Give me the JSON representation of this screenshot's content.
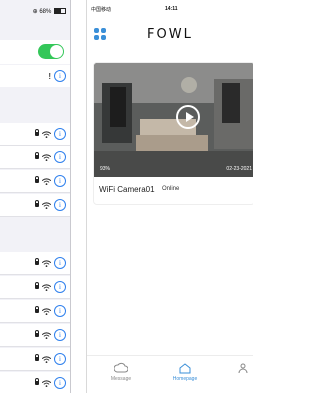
{
  "left_screen": {
    "battery_text": "68%",
    "wifi_enabled": true,
    "info_glyph": "i",
    "alert_glyph": "!",
    "row_count": 10
  },
  "right_screen": {
    "status": {
      "carrier": "中国移动",
      "time": "14:11"
    },
    "brand": "FOWL",
    "camera": {
      "name": "WiFi Camera01",
      "status": "Online",
      "battery": "93%",
      "timestamp": "02-23-2021"
    },
    "nav": [
      {
        "label": "Message",
        "icon": "cloud-icon"
      },
      {
        "label": "Homepage",
        "icon": "home-icon"
      },
      {
        "label": "",
        "icon": "person-icon"
      }
    ],
    "colors": {
      "accent": "#3a8fd8",
      "toggle_on": "#34c759"
    }
  }
}
